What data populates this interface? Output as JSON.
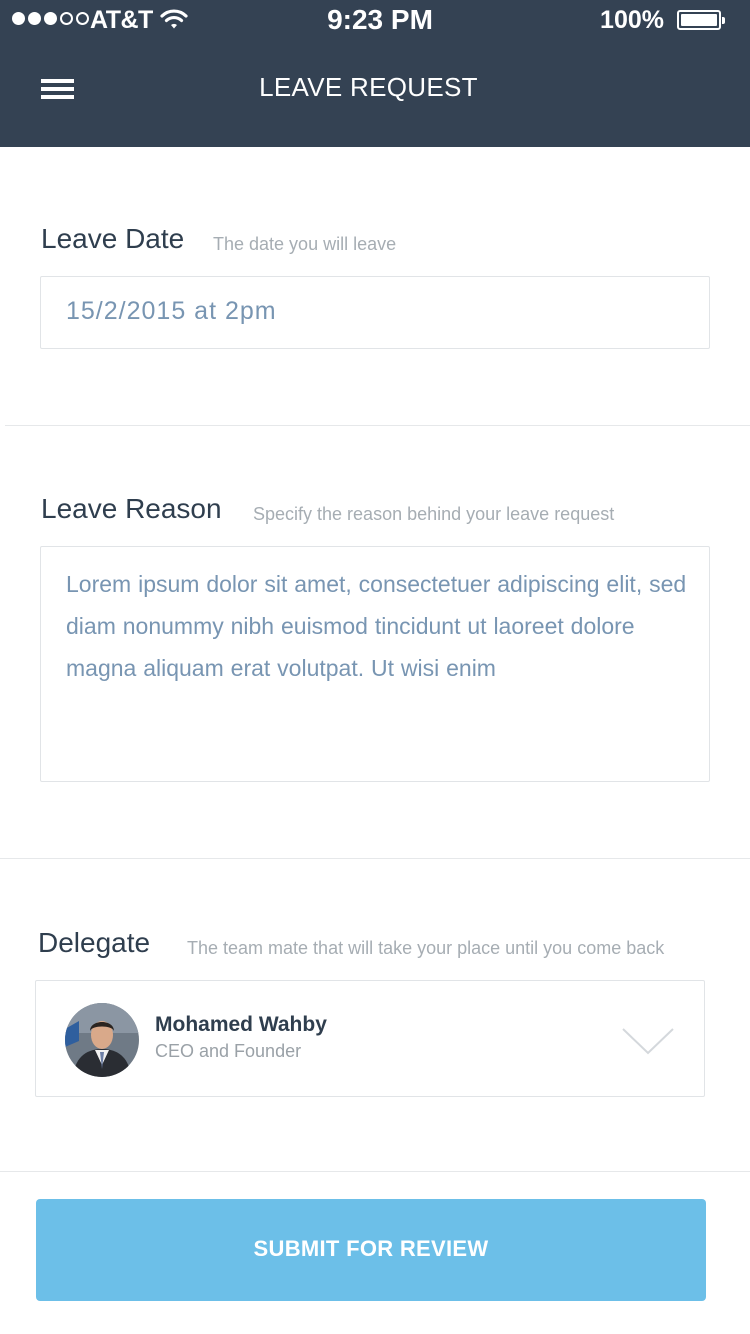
{
  "status_bar": {
    "signal_dots": [
      true,
      true,
      true,
      false,
      false
    ],
    "carrier": "AT&T",
    "time": "9:23 PM",
    "battery": "100%",
    "battery_level": 1.0
  },
  "header": {
    "title": "LEAVE REQUEST",
    "background_color": "#344253"
  },
  "leave_date": {
    "label": "Leave Date",
    "hint": "The date you will leave",
    "value": "15/2/2015 at 2pm"
  },
  "leave_reason": {
    "label": "Leave Reason",
    "hint": "Specify the reason behind your leave request",
    "value": "Lorem ipsum dolor sit amet, consectetuer adipiscing elit, sed diam nonummy nibh euismod tincidunt ut laoreet dolore magna aliquam erat volutpat. Ut wisi enim"
  },
  "delegate": {
    "label": "Delegate",
    "hint": "The team mate that will take your place until you come back",
    "selected": {
      "name": "Mohamed Wahby",
      "role": "CEO and Founder"
    }
  },
  "submit": {
    "label": "SUBMIT FOR REVIEW",
    "color": "#6cbfe8"
  }
}
